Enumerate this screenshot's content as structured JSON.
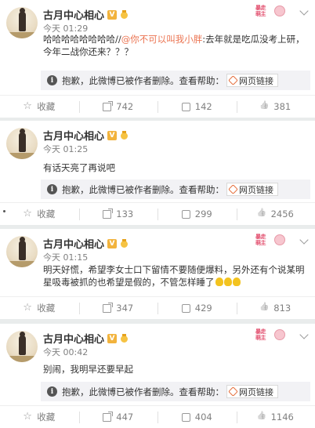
{
  "user": {
    "name": "古月中心相心",
    "v_badge": "V"
  },
  "deco_text": "暴走\n萌主",
  "posts": [
    {
      "time": "今天 01:29",
      "text_plain": "哈哈哈哈哈哈哈哈//",
      "mention": "@你不可以叫我小胖",
      "text_rest": ":去年就是吃瓜没考上研，今年二战你还来？？？",
      "deleted_notice": "抱歉，此微博已被作者删除。查看帮助：",
      "link_label": "网页链接",
      "favorite_label": "收藏",
      "share_count": "742",
      "comment_count": "142",
      "like_count": "381"
    },
    {
      "time": "今天 01:25",
      "text_plain": "有话天亮了再说吧",
      "deleted_notice": "抱歉，此微博已被作者删除。查看帮助：",
      "link_label": "网页链接",
      "favorite_label": "收藏",
      "share_count": "133",
      "comment_count": "299",
      "like_count": "2456"
    },
    {
      "time": "今天 01:15",
      "text_plain": "明天好慌，希望李女士口下留情不要随便爆料，另外还有个说某明星吸毒被抓的也希望是假的，不管怎样睡了",
      "favorite_label": "收藏",
      "share_count": "347",
      "comment_count": "429",
      "like_count": "813"
    },
    {
      "time": "今天 00:42",
      "text_plain": "别闹，我明早还要早起",
      "deleted_notice": "抱歉，此微博已被作者删除。查看帮助：",
      "link_label": "网页链接",
      "favorite_label": "收藏",
      "share_count": "447",
      "comment_count": "404",
      "like_count": "1146"
    }
  ]
}
